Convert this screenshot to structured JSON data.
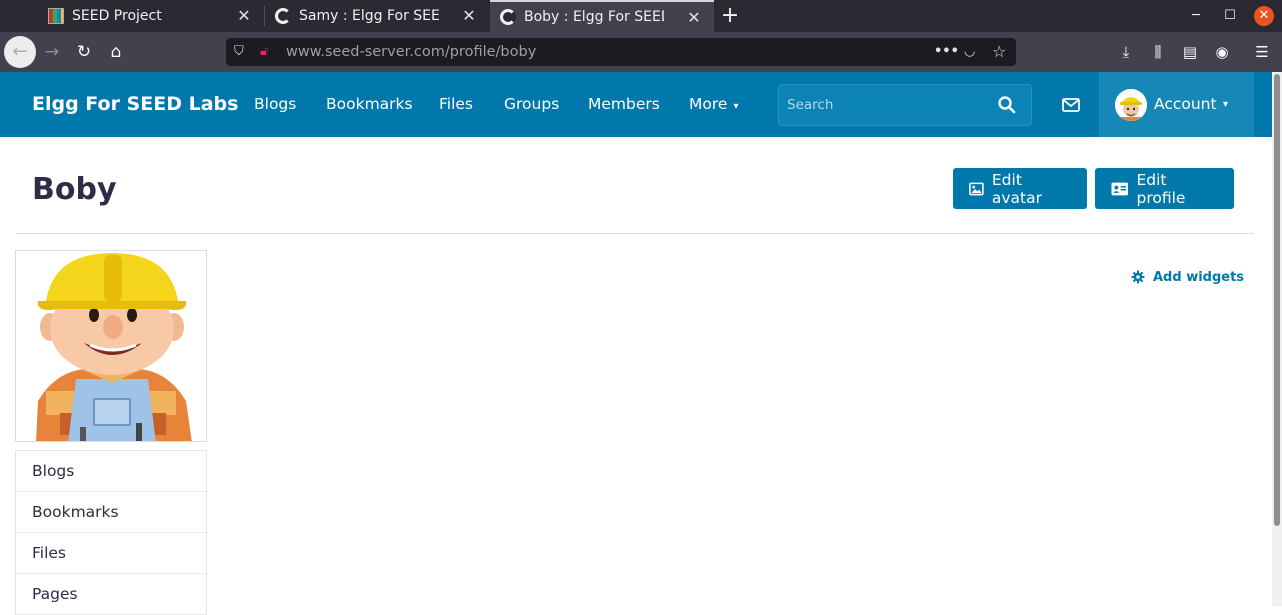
{
  "browser": {
    "tabs": [
      {
        "title": "SEED Project",
        "favicon": "seed-favicon-icon",
        "active": false
      },
      {
        "title": "Samy : Elgg For SEED Labs",
        "favicon": "elgg-favicon-icon",
        "active": false
      },
      {
        "title": "Boby : Elgg For SEED Labs",
        "favicon": "elgg-favicon-icon",
        "active": true
      }
    ],
    "url": {
      "host": "www.seed-server.com",
      "path": "/profile/boby"
    }
  },
  "site": {
    "name": "Elgg For SEED Labs",
    "menu": [
      "Blogs",
      "Bookmarks",
      "Files",
      "Groups",
      "Members",
      "More"
    ],
    "search_placeholder": "Search",
    "account_label": "Account",
    "accent": "#0078ac"
  },
  "profile": {
    "name": "Boby",
    "edit_avatar_label": "Edit avatar",
    "edit_profile_label": "Edit profile",
    "add_widgets_label": "Add widgets",
    "owner_menu": [
      "Blogs",
      "Bookmarks",
      "Files",
      "Pages"
    ]
  }
}
